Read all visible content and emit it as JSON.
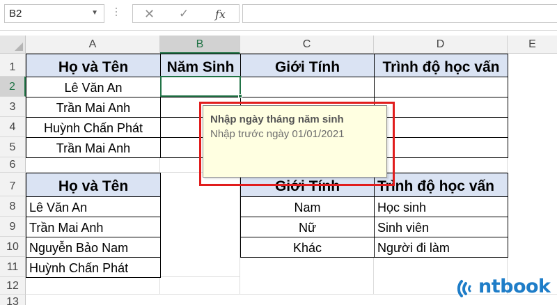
{
  "formula_bar": {
    "name_box": "B2",
    "cancel_icon": "✕",
    "confirm_icon": "✓",
    "function_icon": "fx",
    "formula": ""
  },
  "columns": [
    {
      "letter": "A",
      "selected": false
    },
    {
      "letter": "B",
      "selected": true
    },
    {
      "letter": "C",
      "selected": false
    },
    {
      "letter": "D",
      "selected": false
    },
    {
      "letter": "E",
      "selected": false
    }
  ],
  "rows": [
    {
      "number": "1",
      "selected": false
    },
    {
      "number": "2",
      "selected": true
    },
    {
      "number": "3",
      "selected": false
    },
    {
      "number": "4",
      "selected": false
    },
    {
      "number": "5",
      "selected": false
    },
    {
      "number": "6",
      "selected": false
    },
    {
      "number": "7",
      "selected": false
    },
    {
      "number": "8",
      "selected": false
    },
    {
      "number": "9",
      "selected": false
    },
    {
      "number": "10",
      "selected": false
    },
    {
      "number": "11",
      "selected": false
    },
    {
      "number": "12",
      "selected": false
    },
    {
      "number": "13",
      "selected": false
    }
  ],
  "table1": {
    "headers": {
      "name": "Họ và Tên",
      "birth_year": "Năm Sinh",
      "gender": "Giới Tính",
      "education": "Trình độ học vấn"
    },
    "names": [
      "Lê Văn An",
      "Trần Mai Anh",
      "Huỳnh Chấn Phát",
      "Trần Mai Anh"
    ]
  },
  "table2": {
    "name_header": "Họ và Tên",
    "names": [
      "Lê Văn An",
      "Trần Mai Anh",
      "Nguyễn Bảo Nam",
      "Huỳnh Chấn Phát"
    ]
  },
  "table3": {
    "gender_header": "Giới Tính",
    "education_header": "Trình độ học vấn",
    "genders": [
      "Nam",
      "Nữ",
      "Khác"
    ],
    "education_levels": [
      "Học sinh",
      "Sinh viên",
      "Người đi làm"
    ]
  },
  "input_message": {
    "title": "Nhập ngày tháng năm sinh",
    "message": "Nhập trước ngày 01/01/2021"
  },
  "colors": {
    "header_fill": "#dae3f3",
    "selection": "#217346",
    "tooltip_bg": "#ffffe1",
    "highlight_box": "#e11d1d",
    "logo": "#1e7dc8"
  },
  "logo": {
    "text": "ntbook",
    "icon": "rounded-wave-icon"
  }
}
